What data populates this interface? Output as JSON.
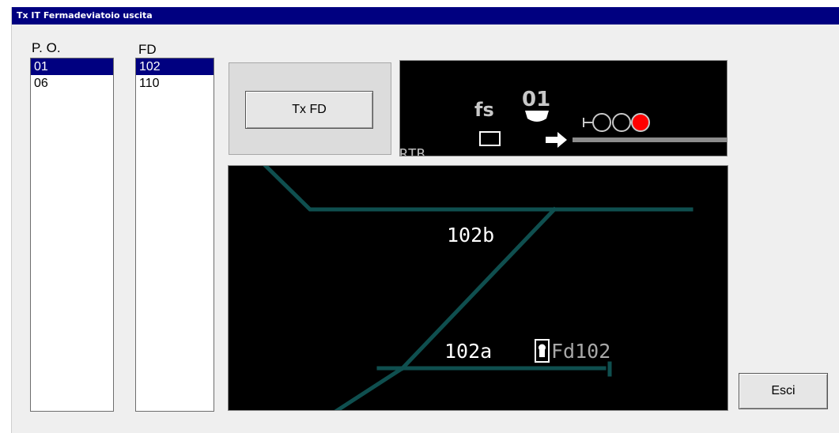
{
  "window": {
    "title": "Tx IT Fermadeviatoio uscita"
  },
  "po": {
    "label": "P. O.",
    "items": [
      "01",
      "06"
    ],
    "selected": 0
  },
  "fd": {
    "label": "FD",
    "items": [
      "102",
      "110"
    ],
    "selected": 0
  },
  "tx_button": {
    "label": "Tx FD"
  },
  "signal_view": {
    "fs_label": "fs",
    "number_label": "01",
    "bottom_label": "RTB",
    "lamp_colors": [
      "#000000",
      "#000000",
      "#ff0000"
    ]
  },
  "track_view": {
    "label_upper": "102b",
    "label_lower": "102a",
    "switch_label": "Fd102",
    "track_color": "#0f4f4f"
  },
  "exit_button": {
    "label": "Esci"
  }
}
